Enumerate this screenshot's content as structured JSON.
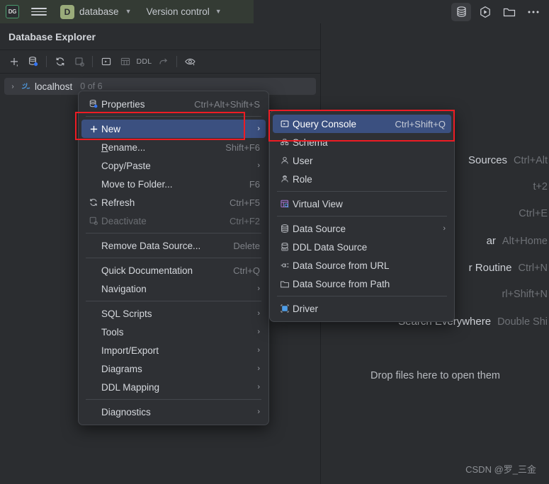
{
  "titlebar": {
    "logo_text": "DG",
    "menu_icon": "hamburger-icon",
    "project_badge": "D",
    "project_name": "database",
    "vcs_label": "Version control",
    "right_icons": [
      "database-icon",
      "run-icon",
      "folder-icon",
      "more-icon"
    ]
  },
  "explorer": {
    "title": "Database Explorer",
    "toolbar": [
      {
        "name": "add-icon",
        "label": "+"
      },
      {
        "name": "data-source-properties-icon",
        "label": ""
      },
      {
        "name": "refresh-icon",
        "label": ""
      },
      {
        "name": "deactivate-icon",
        "label": ""
      },
      {
        "name": "query-console-icon",
        "label": ""
      },
      {
        "name": "table-icon",
        "label": ""
      },
      {
        "name": "ddl-icon",
        "label": "DDL"
      },
      {
        "name": "jump-to-icon",
        "label": ""
      },
      {
        "name": "eye-icon",
        "label": ""
      }
    ],
    "tree": {
      "arrow": "›",
      "icon": "mysql-dolphin-icon",
      "label": "localhost",
      "sublabel": "0 of 6"
    }
  },
  "editor": {
    "hints": [
      {
        "action": "Sources",
        "key": "Ctrl+Alt"
      },
      {
        "action": "",
        "key": "t+2"
      },
      {
        "action": "",
        "key": "Ctrl+E"
      },
      {
        "action": "ar",
        "key": "Alt+Home"
      },
      {
        "action": "r Routine",
        "key": "Ctrl+N"
      },
      {
        "action": "",
        "key": "rl+Shift+N"
      },
      {
        "action": "Search Everywhere",
        "key": "Double Shi"
      }
    ],
    "drop_hint": "Drop files here to open them",
    "watermark": "CSDN @罗_三金"
  },
  "context_menu": {
    "items": [
      {
        "type": "item",
        "icon": "data-source-properties-icon",
        "label": "Properties",
        "key": "Ctrl+Alt+Shift+S",
        "selected": false,
        "disabled": false,
        "submenu": false
      },
      {
        "type": "separator"
      },
      {
        "type": "item",
        "icon": "plus-icon",
        "label": "New",
        "key": "",
        "selected": true,
        "disabled": false,
        "submenu": true
      },
      {
        "type": "item",
        "icon": "",
        "label": "Rename...",
        "key": "Shift+F6",
        "selected": false,
        "disabled": false,
        "submenu": false,
        "mnemonic": "R"
      },
      {
        "type": "item",
        "icon": "",
        "label": "Copy/Paste",
        "key": "",
        "selected": false,
        "disabled": false,
        "submenu": true
      },
      {
        "type": "item",
        "icon": "",
        "label": "Move to Folder...",
        "key": "F6",
        "selected": false,
        "disabled": false,
        "submenu": false
      },
      {
        "type": "item",
        "icon": "refresh-icon",
        "label": "Refresh",
        "key": "Ctrl+F5",
        "selected": false,
        "disabled": false,
        "submenu": false
      },
      {
        "type": "item",
        "icon": "deactivate-icon",
        "label": "Deactivate",
        "key": "Ctrl+F2",
        "selected": false,
        "disabled": true,
        "submenu": false
      },
      {
        "type": "separator"
      },
      {
        "type": "item",
        "icon": "",
        "label": "Remove Data Source...",
        "key": "Delete",
        "selected": false,
        "disabled": false,
        "submenu": false
      },
      {
        "type": "separator"
      },
      {
        "type": "item",
        "icon": "",
        "label": "Quick Documentation",
        "key": "Ctrl+Q",
        "selected": false,
        "disabled": false,
        "submenu": false,
        "mnemonic": "D"
      },
      {
        "type": "item",
        "icon": "",
        "label": "Navigation",
        "key": "",
        "selected": false,
        "disabled": false,
        "submenu": true
      },
      {
        "type": "separator"
      },
      {
        "type": "item",
        "icon": "",
        "label": "SQL Scripts",
        "key": "",
        "selected": false,
        "disabled": false,
        "submenu": true
      },
      {
        "type": "item",
        "icon": "",
        "label": "Tools",
        "key": "",
        "selected": false,
        "disabled": false,
        "submenu": true
      },
      {
        "type": "item",
        "icon": "",
        "label": "Import/Export",
        "key": "",
        "selected": false,
        "disabled": false,
        "submenu": true
      },
      {
        "type": "item",
        "icon": "",
        "label": "Diagrams",
        "key": "",
        "selected": false,
        "disabled": false,
        "submenu": true
      },
      {
        "type": "item",
        "icon": "",
        "label": "DDL Mapping",
        "key": "",
        "selected": false,
        "disabled": false,
        "submenu": true
      },
      {
        "type": "separator"
      },
      {
        "type": "item",
        "icon": "",
        "label": "Diagnostics",
        "key": "",
        "selected": false,
        "disabled": false,
        "submenu": true
      }
    ]
  },
  "sub_menu": {
    "items": [
      {
        "type": "item",
        "icon": "query-console-icon",
        "label": "Query Console",
        "key": "Ctrl+Shift+Q",
        "selected": true,
        "submenu": false
      },
      {
        "type": "item",
        "icon": "schema-icon",
        "label": "Schema",
        "key": "",
        "selected": false,
        "submenu": false
      },
      {
        "type": "item",
        "icon": "user-icon",
        "label": "User",
        "key": "",
        "selected": false,
        "submenu": false
      },
      {
        "type": "item",
        "icon": "role-icon",
        "label": "Role",
        "key": "",
        "selected": false,
        "submenu": false
      },
      {
        "type": "separator"
      },
      {
        "type": "item",
        "icon": "virtual-view-icon",
        "label": "Virtual View",
        "key": "",
        "selected": false,
        "submenu": false
      },
      {
        "type": "separator"
      },
      {
        "type": "item",
        "icon": "database-icon",
        "label": "Data Source",
        "key": "",
        "selected": false,
        "submenu": true
      },
      {
        "type": "item",
        "icon": "ddl-data-source-icon",
        "label": "DDL Data Source",
        "key": "",
        "selected": false,
        "submenu": false
      },
      {
        "type": "item",
        "icon": "url-icon",
        "label": "Data Source from URL",
        "key": "",
        "selected": false,
        "submenu": false
      },
      {
        "type": "item",
        "icon": "folder-icon",
        "label": "Data Source from Path",
        "key": "",
        "selected": false,
        "submenu": false
      },
      {
        "type": "separator"
      },
      {
        "type": "item",
        "icon": "driver-icon",
        "label": "Driver",
        "key": "",
        "selected": false,
        "submenu": false
      }
    ]
  },
  "annotations": {
    "color": "#ed1c24",
    "boxes": [
      "new-menu-item-highlight",
      "query-console-item-highlight"
    ]
  }
}
